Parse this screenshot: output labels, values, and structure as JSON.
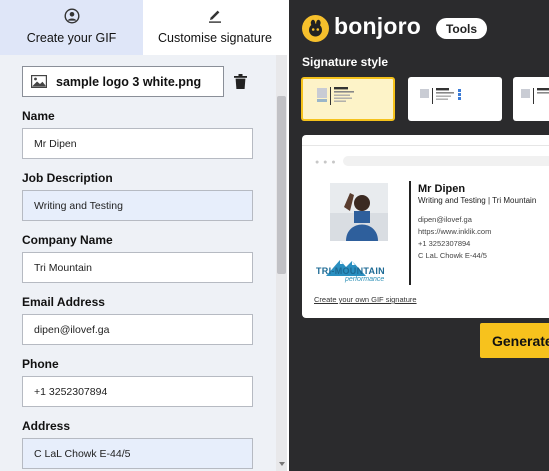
{
  "tabs": [
    {
      "label": "Create your GIF",
      "icon": "user-circle-icon",
      "active": true
    },
    {
      "label": "Customise signature",
      "icon": "pen-icon",
      "active": false
    }
  ],
  "form": {
    "file_name": "sample logo 3 white.png",
    "fields": [
      {
        "label": "Name",
        "value": "Mr Dipen"
      },
      {
        "label": "Job Description",
        "value": "Writing and Testing"
      },
      {
        "label": "Company Name",
        "value": "Tri Mountain"
      },
      {
        "label": "Email Address",
        "value": "dipen@ilovef.ga"
      },
      {
        "label": "Phone",
        "value": "+1 3252307894"
      },
      {
        "label": "Address",
        "value": "C LaL Chowk E-44/5"
      }
    ]
  },
  "header": {
    "brand": "bonjoro",
    "tools_label": "Tools"
  },
  "signature_style_label": "Signature style",
  "preview": {
    "name": "Mr Dipen",
    "job_line": "Writing and Testing  |  Tri Mountain",
    "email": "dipen@ilovef.ga",
    "website": "https://www.inklik.com",
    "phone": "+1 3252307894",
    "address": "C LaL Chowk E-44/5",
    "company_logo_name": "TRI-MOUNTAIN",
    "company_logo_sub": "performance",
    "link_text": "Create your own GIF signature"
  },
  "generate_label": "Generate",
  "colors": {
    "accent_yellow": "#f7c21d",
    "dark_bg": "#2b2b2d",
    "active_tab": "#dfe6f8"
  }
}
